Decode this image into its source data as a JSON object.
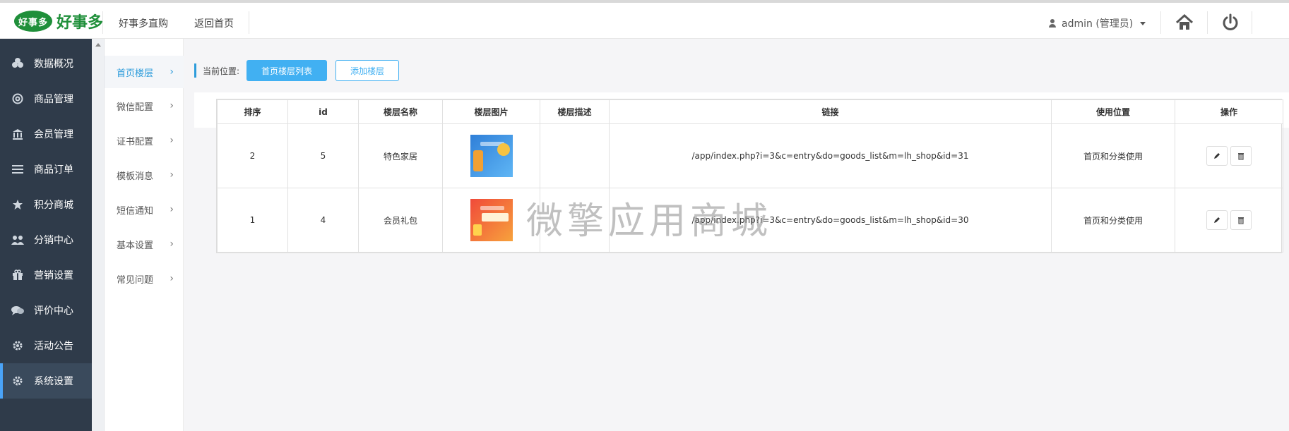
{
  "header": {
    "logo_badge": "好事多",
    "logo_text": "好事多",
    "link_direct": "好事多直购",
    "link_home": "返回首页",
    "user_label": "admin (管理员)",
    "home_icon": "home-icon",
    "power_icon": "power-icon"
  },
  "sidebar": {
    "items": [
      {
        "label": "数据概况",
        "icon": "data-overview-icon"
      },
      {
        "label": "商品管理",
        "icon": "product-icon"
      },
      {
        "label": "会员管理",
        "icon": "bank-icon"
      },
      {
        "label": "商品订单",
        "icon": "list-icon"
      },
      {
        "label": "积分商城",
        "icon": "star-icon"
      },
      {
        "label": "分销中心",
        "icon": "users-icon"
      },
      {
        "label": "营销设置",
        "icon": "gift-icon"
      },
      {
        "label": "评价中心",
        "icon": "comment-icon"
      },
      {
        "label": "活动公告",
        "icon": "gear-icon"
      },
      {
        "label": "系统设置",
        "icon": "gear-icon",
        "active": true
      }
    ]
  },
  "submenu": {
    "items": [
      {
        "label": "首页楼层",
        "active": true
      },
      {
        "label": "微信配置"
      },
      {
        "label": "证书配置"
      },
      {
        "label": "模板消息"
      },
      {
        "label": "短信通知"
      },
      {
        "label": "基本设置"
      },
      {
        "label": "常见问题"
      }
    ]
  },
  "toolbar": {
    "crumb_label": "当前位置:",
    "list_button": "首页楼层列表",
    "add_button": "添加楼层"
  },
  "table": {
    "headers": [
      "排序",
      "id",
      "楼层名称",
      "楼层图片",
      "楼层描述",
      "链接",
      "使用位置",
      "操作"
    ],
    "rows": [
      {
        "order": "2",
        "id": "5",
        "name": "特色家居",
        "desc": "",
        "link": "/app/index.php?i=3&c=entry&do=goods_list&m=lh_shop&id=31",
        "position": "首页和分类使用"
      },
      {
        "order": "1",
        "id": "4",
        "name": "会员礼包",
        "desc": "",
        "link": "/app/index.php?i=3&c=entry&do=goods_list&m=lh_shop&id=30",
        "position": "首页和分类使用"
      }
    ]
  },
  "watermark": "微擎应用商城",
  "colors": {
    "sidebar_bg": "#2f3b4a",
    "accent_blue": "#41b0f2",
    "logo_green": "#1f8f3a"
  }
}
